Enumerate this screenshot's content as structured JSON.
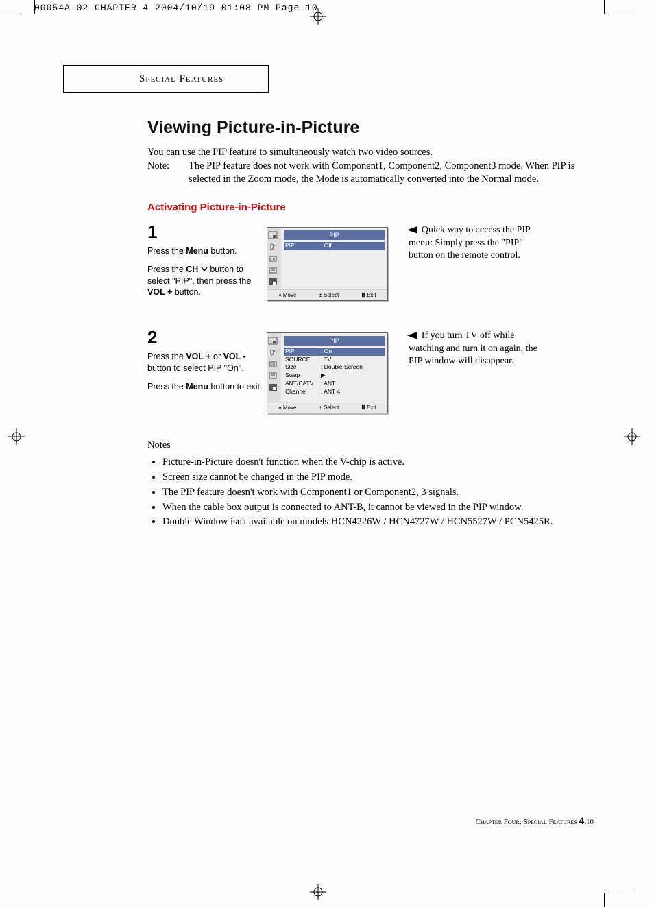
{
  "header_tag": "00054A-02-CHAPTER 4  2004/10/19  01:08 PM  Page 10",
  "section_header": "Special Features",
  "title": "Viewing Picture-in-Picture",
  "intro_line": "You can use the PIP feature to simultaneously watch two video sources.",
  "note_label": "Note:",
  "note_body": "The PIP feature does not work with Component1, Component2, Component3 mode. When PIP is selected in the Zoom mode, the Mode is automatically converted into the Normal mode.",
  "sub_heading": "Activating Picture-in-Picture",
  "step1": {
    "num": "1",
    "p1_a": "Press the ",
    "p1_b": "Menu",
    "p1_c": " button.",
    "p2_a": "Press the ",
    "p2_b": "CH",
    "p2_c": " button to select \"PIP\", then press the ",
    "p2_d": "VOL +",
    "p2_e": " button."
  },
  "step2": {
    "num": "2",
    "p1_a": "Press the ",
    "p1_b": "VOL +",
    "p1_c": " or ",
    "p1_d": "VOL -",
    "p1_e": " button  to select PIP \"On\".",
    "p2_a": "Press the ",
    "p2_b": "Menu",
    "p2_c": " button to exit."
  },
  "osd1": {
    "title": "PIP",
    "rows": [
      {
        "k": "PIP",
        "v": ": Off",
        "sel": true
      }
    ]
  },
  "osd2": {
    "title": "PIP",
    "rows": [
      {
        "k": "PIP",
        "v": ": On",
        "sel": true
      },
      {
        "k": "SOURCE",
        "v": ": TV"
      },
      {
        "k": "Size",
        "v": ": Double Screen"
      },
      {
        "k": "Swap",
        "v": "▶"
      },
      {
        "k": "ANT/CATV",
        "v": ": ANT"
      },
      {
        "k": "Channel",
        "v": ": ANT 4"
      }
    ]
  },
  "osd_foot": {
    "move": "Move",
    "select": "Select",
    "exit": "Exit"
  },
  "tip1": "Quick way to access the PIP menu: Simply press the \"PIP\" button on the remote control.",
  "tip2": "If you turn TV off while watching and turn it on again, the PIP window will disappear.",
  "notes_label": "Notes",
  "notes": [
    "Picture-in-Picture doesn't function when the V-chip is active.",
    "Screen size cannot be changed in the PIP mode.",
    "The PIP feature doesn't work with Component1 or Component2, 3 signals.",
    "When the cable box output is connected to ANT-B, it cannot be viewed in the PIP window.",
    "Double Window isn't available on models HCN4226W / HCN4727W / HCN5527W / PCN5425R."
  ],
  "footer_a": "Chapter Four: Special Features ",
  "footer_pg": "4",
  "footer_dot": ".10"
}
